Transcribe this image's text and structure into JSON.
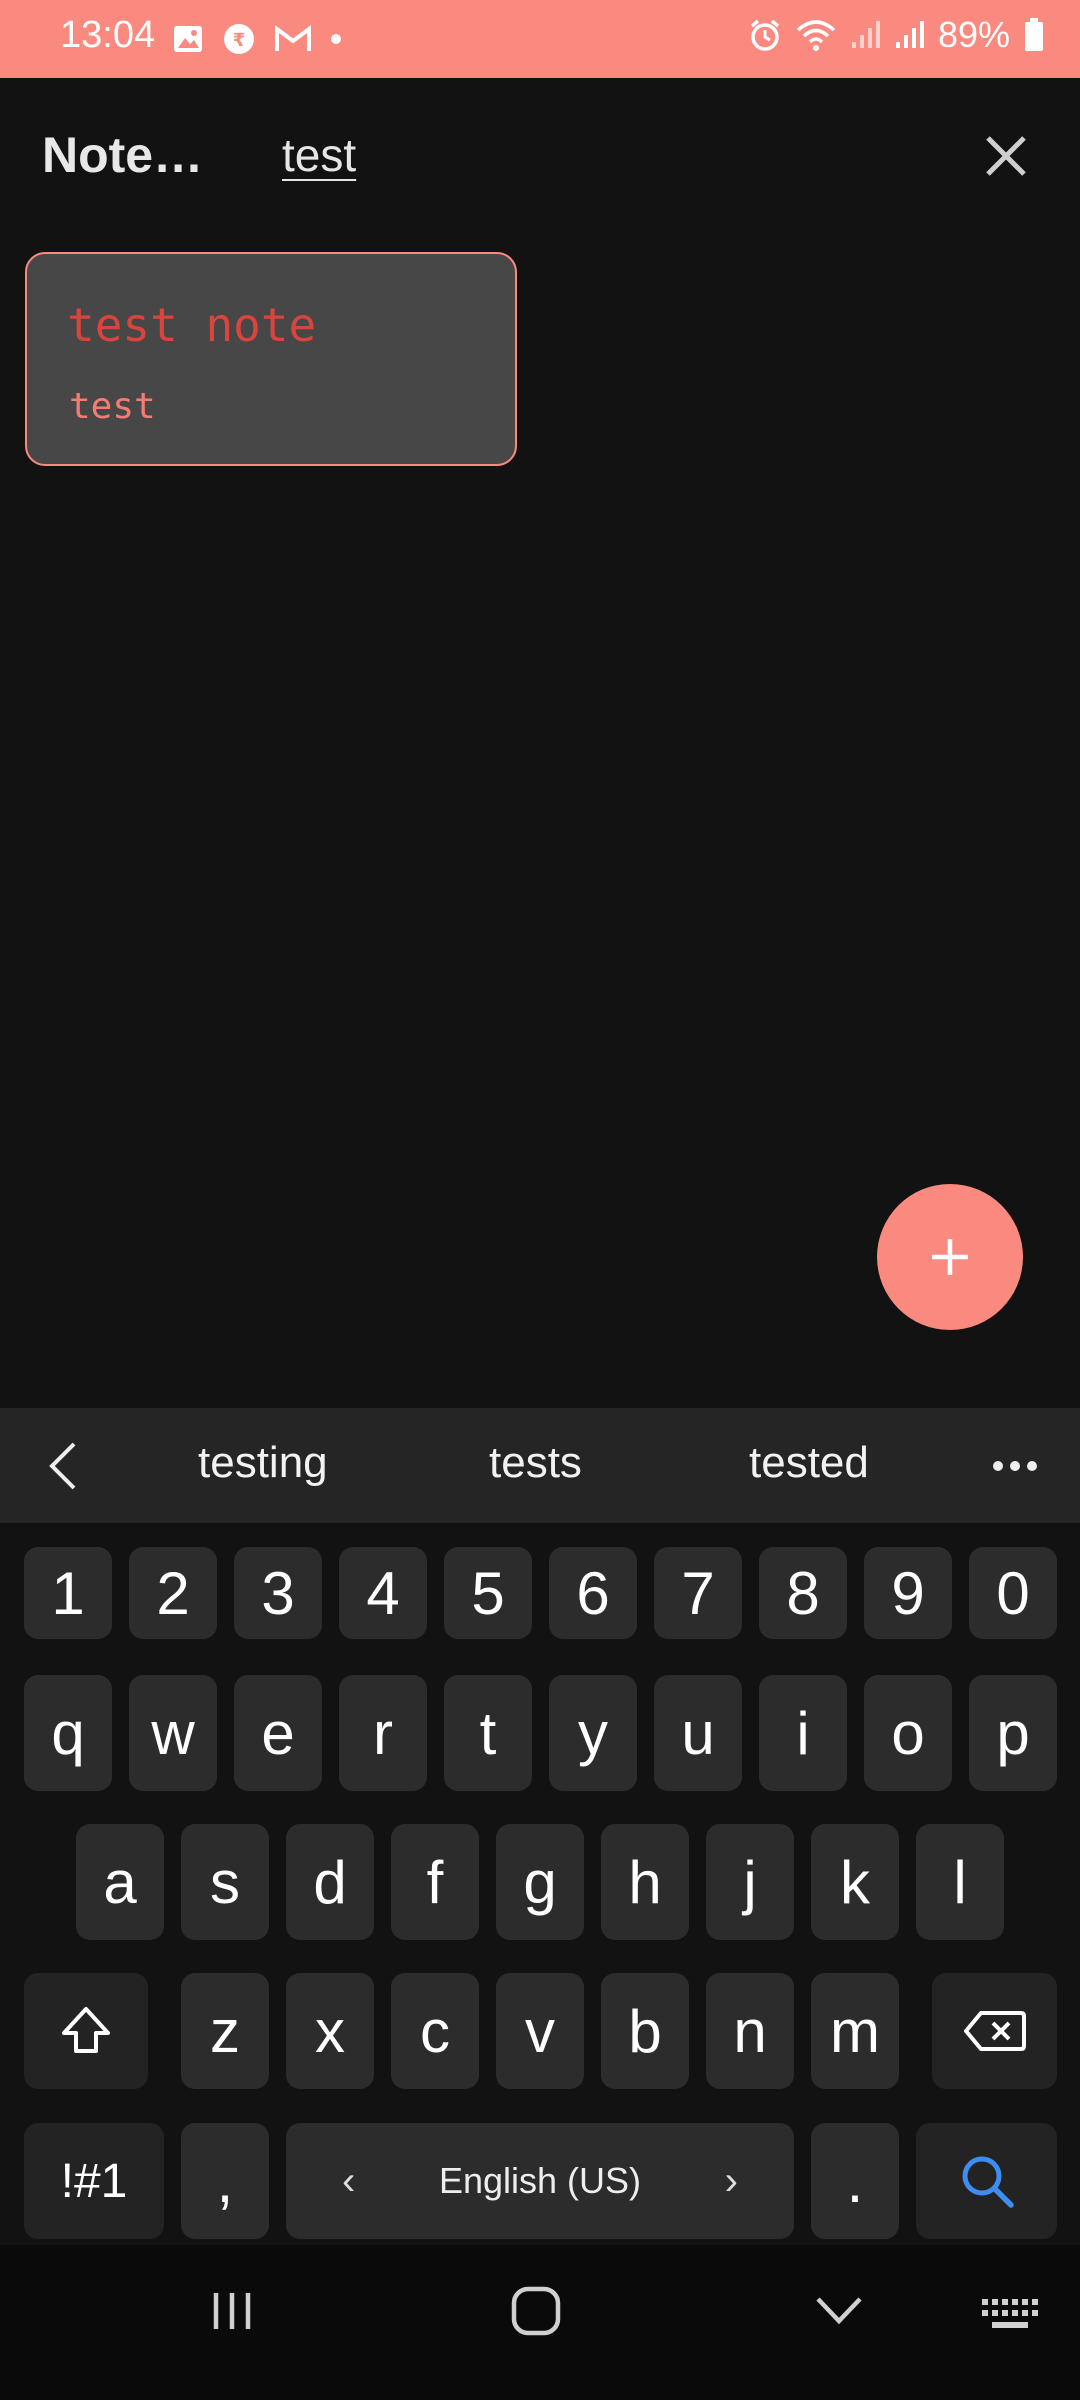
{
  "status_bar": {
    "time": "13:04",
    "battery": "89%",
    "left_icons": [
      "gallery-icon",
      "app-notification-icon",
      "gmail-icon",
      "dot-icon"
    ],
    "right_icons": [
      "alarm-icon",
      "wifi-icon",
      "signal-icon",
      "signal-icon",
      "battery-icon"
    ]
  },
  "header": {
    "title": "Note…",
    "search_value": "test"
  },
  "notes": [
    {
      "title": "test note",
      "body": "test"
    }
  ],
  "fab": {
    "icon": "plus-icon"
  },
  "keyboard": {
    "suggestions": [
      "testing",
      "tests",
      "tested"
    ],
    "number_row": [
      "1",
      "2",
      "3",
      "4",
      "5",
      "6",
      "7",
      "8",
      "9",
      "0"
    ],
    "row1": [
      "q",
      "w",
      "e",
      "r",
      "t",
      "y",
      "u",
      "i",
      "o",
      "p"
    ],
    "row2": [
      "a",
      "s",
      "d",
      "f",
      "g",
      "h",
      "j",
      "k",
      "l"
    ],
    "row3": [
      "z",
      "x",
      "c",
      "v",
      "b",
      "n",
      "m"
    ],
    "symbols_label": "!#1",
    "comma": ",",
    "space_label": "English (US)",
    "period": "."
  },
  "colors": {
    "accent": "#fa8a80",
    "note_title": "#d9443d",
    "note_body": "#f47c73",
    "search_key": "#3d8ef0"
  }
}
